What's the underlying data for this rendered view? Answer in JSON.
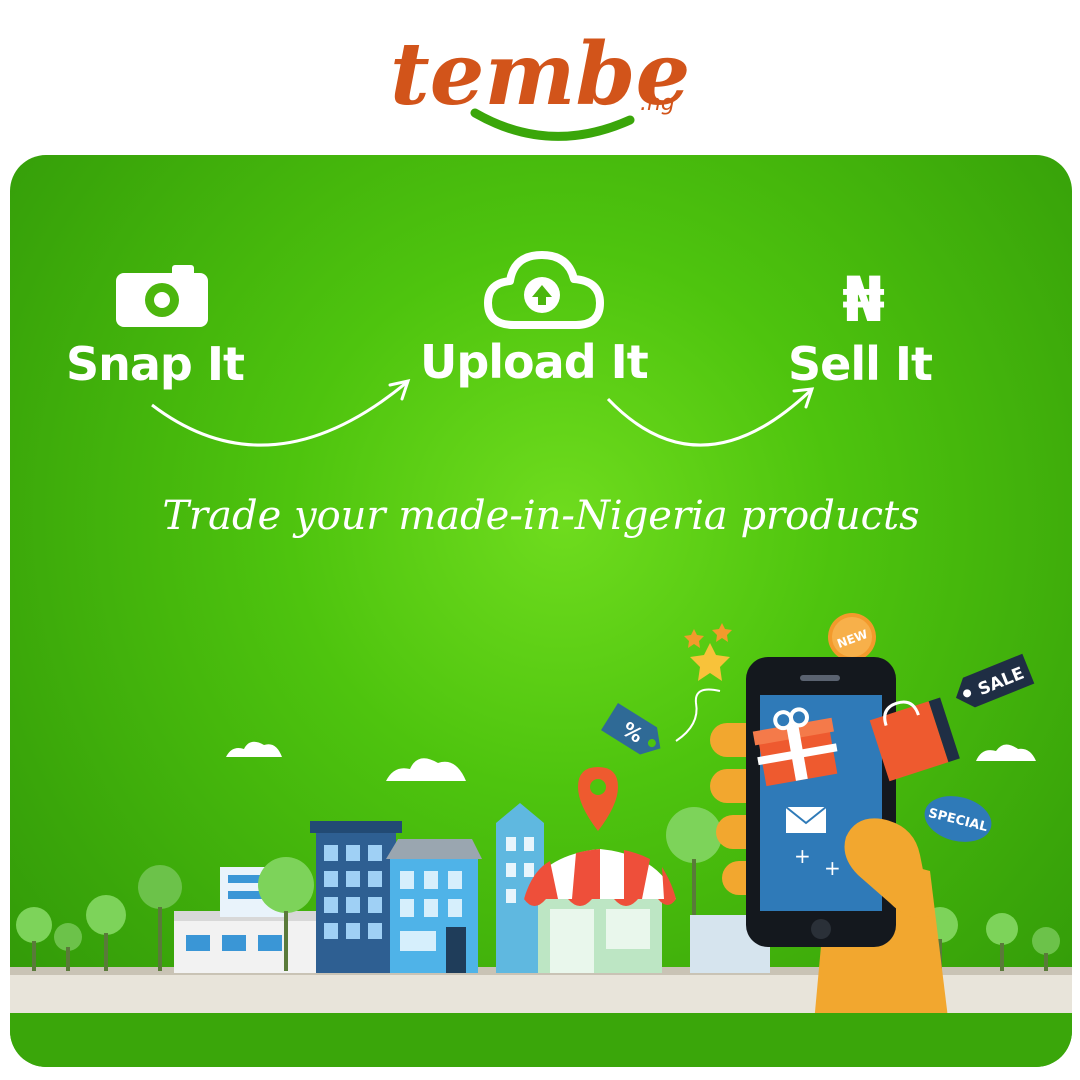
{
  "logo": {
    "name": "tembe",
    "suffix": ".ng"
  },
  "steps": [
    {
      "label": "Snap It",
      "icon": "camera-icon"
    },
    {
      "label": "Upload It",
      "icon": "cloud-upload-icon"
    },
    {
      "label": "Sell It",
      "icon": "naira-icon"
    }
  ],
  "currency_symbol": "₦",
  "tagline": "Trade your made-in-Nigeria products",
  "tags": {
    "percent": "%",
    "new": "NEW",
    "sale": "SALE",
    "special": "SPECIAL"
  },
  "colors": {
    "brand_orange": "#d2541a",
    "brand_green": "#3aa60a",
    "background_green": "#4ec40e"
  }
}
